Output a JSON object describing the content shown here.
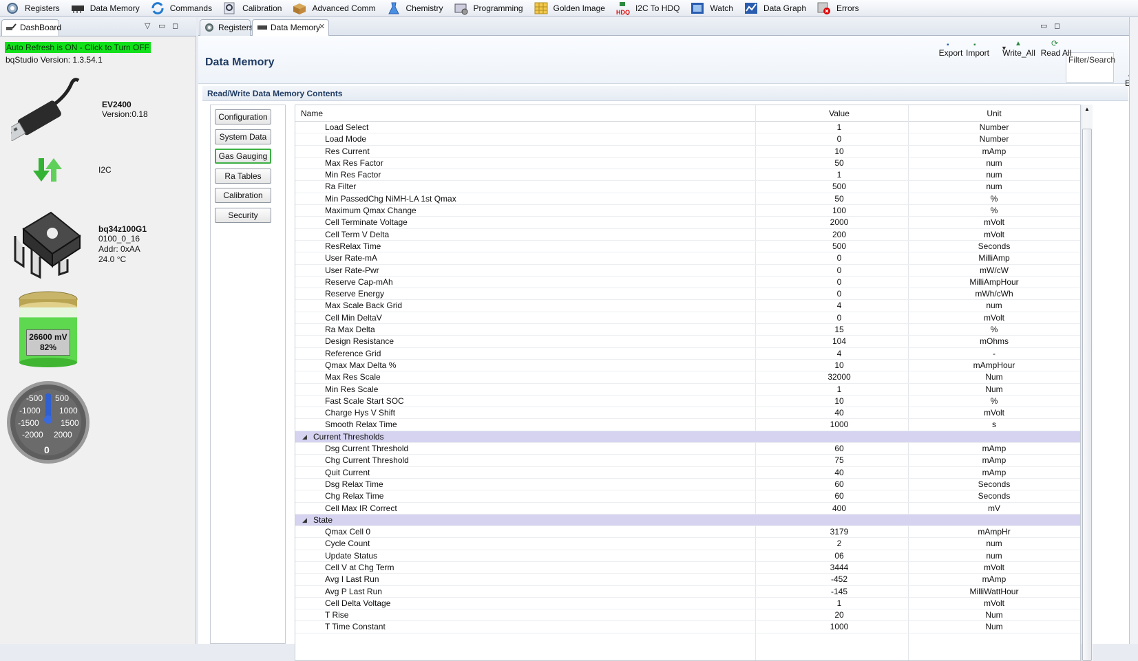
{
  "toolbar": {
    "items": [
      {
        "label": "Registers",
        "icon": "gear-icon"
      },
      {
        "label": "Data Memory",
        "icon": "memory-chip-icon"
      },
      {
        "label": "Commands",
        "icon": "refresh-arrows-icon"
      },
      {
        "label": "Calibration",
        "icon": "magnifier-icon"
      },
      {
        "label": "Advanced Comm",
        "icon": "package-icon"
      },
      {
        "label": "Chemistry",
        "icon": "flask-icon"
      },
      {
        "label": "Programming",
        "icon": "programming-icon"
      },
      {
        "label": "Golden Image",
        "icon": "grid-icon"
      },
      {
        "label": "I2C To HDQ",
        "icon": "hdq-icon"
      },
      {
        "label": "Watch",
        "icon": "watch-icon"
      },
      {
        "label": "Data Graph",
        "icon": "graph-icon"
      },
      {
        "label": "Errors",
        "icon": "error-icon"
      }
    ],
    "hdq_badge": "HDQ"
  },
  "dashboard": {
    "tab_label": "DashBoard",
    "auto_refresh": "Auto Refresh is ON - Click to Turn OFF",
    "version": "bqStudio Version:  1.3.54.1",
    "adapter": {
      "name": "EV2400",
      "version": "Version:0.18"
    },
    "protocol": "I2C",
    "device": {
      "name": "bq34z100G1",
      "fw": "0100_0_16",
      "addr": "Addr: 0xAA",
      "temp": "24.0 °C"
    },
    "battery": {
      "voltage": "26600 mV",
      "soc": "82%",
      "fill_fraction": 0.82
    },
    "gauge": {
      "labels_left": [
        "-500",
        "-1000",
        "-1500",
        "-2000"
      ],
      "labels_right": [
        "500",
        "1000",
        "1500",
        "2000"
      ],
      "value": "0"
    }
  },
  "main": {
    "tabs": [
      {
        "label": "Registers"
      },
      {
        "label": "Data Memory"
      }
    ],
    "title": "Data Memory",
    "filter_placeholder": "Filter/Search",
    "buttons": {
      "auto_export": "Auto Export",
      "export": "Export",
      "import": "Import",
      "write_all": "Write_All",
      "read_all": "Read All"
    },
    "section_title": "Read/Write Data Memory Contents",
    "classes": [
      "Configuration",
      "System Data",
      "Gas Gauging",
      "Ra Tables",
      "Calibration",
      "Security"
    ],
    "active_class": "Gas Gauging",
    "columns": {
      "name": "Name",
      "value": "Value",
      "unit": "Unit"
    },
    "rows": [
      {
        "name": "Load Select",
        "value": "1",
        "unit": "Number"
      },
      {
        "name": "Load Mode",
        "value": "0",
        "unit": "Number"
      },
      {
        "name": "Res Current",
        "value": "10",
        "unit": "mAmp"
      },
      {
        "name": "Max Res Factor",
        "value": "50",
        "unit": "num"
      },
      {
        "name": "Min Res Factor",
        "value": "1",
        "unit": "num"
      },
      {
        "name": "Ra Filter",
        "value": "500",
        "unit": "num"
      },
      {
        "name": "Min PassedChg NiMH-LA 1st Qmax",
        "value": "50",
        "unit": "%"
      },
      {
        "name": "Maximum Qmax Change",
        "value": "100",
        "unit": "%"
      },
      {
        "name": "Cell Terminate Voltage",
        "value": "2000",
        "unit": "mVolt"
      },
      {
        "name": "Cell Term V Delta",
        "value": "200",
        "unit": "mVolt"
      },
      {
        "name": "ResRelax Time",
        "value": "500",
        "unit": "Seconds"
      },
      {
        "name": "User Rate-mA",
        "value": "0",
        "unit": "MilliAmp"
      },
      {
        "name": "User Rate-Pwr",
        "value": "0",
        "unit": "mW/cW"
      },
      {
        "name": "Reserve Cap-mAh",
        "value": "0",
        "unit": "MilliAmpHour"
      },
      {
        "name": "Reserve Energy",
        "value": "0",
        "unit": "mWh/cWh"
      },
      {
        "name": "Max Scale Back Grid",
        "value": "4",
        "unit": "num"
      },
      {
        "name": "Cell Min DeltaV",
        "value": "0",
        "unit": "mVolt"
      },
      {
        "name": "Ra Max Delta",
        "value": "15",
        "unit": "%"
      },
      {
        "name": "Design Resistance",
        "value": "104",
        "unit": "mOhms"
      },
      {
        "name": "Reference Grid",
        "value": "4",
        "unit": "-"
      },
      {
        "name": "Qmax Max Delta %",
        "value": "10",
        "unit": "mAmpHour"
      },
      {
        "name": "Max Res Scale",
        "value": "32000",
        "unit": "Num"
      },
      {
        "name": "Min Res Scale",
        "value": "1",
        "unit": "Num"
      },
      {
        "name": "Fast Scale Start SOC",
        "value": "10",
        "unit": "%"
      },
      {
        "name": "Charge Hys V Shift",
        "value": "40",
        "unit": "mVolt"
      },
      {
        "name": "Smooth Relax Time",
        "value": "1000",
        "unit": "s"
      },
      {
        "name": "Current Thresholds",
        "group": true
      },
      {
        "name": "Dsg Current Threshold",
        "value": "60",
        "unit": "mAmp"
      },
      {
        "name": "Chg Current Threshold",
        "value": "75",
        "unit": "mAmp"
      },
      {
        "name": "Quit Current",
        "value": "40",
        "unit": "mAmp"
      },
      {
        "name": "Dsg Relax Time",
        "value": "60",
        "unit": "Seconds"
      },
      {
        "name": "Chg Relax Time",
        "value": "60",
        "unit": "Seconds"
      },
      {
        "name": "Cell Max IR Correct",
        "value": "400",
        "unit": "mV"
      },
      {
        "name": "State",
        "group": true
      },
      {
        "name": "Qmax Cell 0",
        "value": "3179",
        "unit": "mAmpHr"
      },
      {
        "name": "Cycle Count",
        "value": "2",
        "unit": "num"
      },
      {
        "name": "Update Status",
        "value": "06",
        "unit": "num"
      },
      {
        "name": "Cell V at Chg Term",
        "value": "3444",
        "unit": "mVolt"
      },
      {
        "name": "Avg I Last Run",
        "value": "-452",
        "unit": "mAmp"
      },
      {
        "name": "Avg P Last Run",
        "value": "-145",
        "unit": "MilliWattHour"
      },
      {
        "name": "Cell Delta Voltage",
        "value": "1",
        "unit": "mVolt"
      },
      {
        "name": "T Rise",
        "value": "20",
        "unit": "Num"
      },
      {
        "name": "T Time Constant",
        "value": "1000",
        "unit": "Num"
      }
    ]
  }
}
